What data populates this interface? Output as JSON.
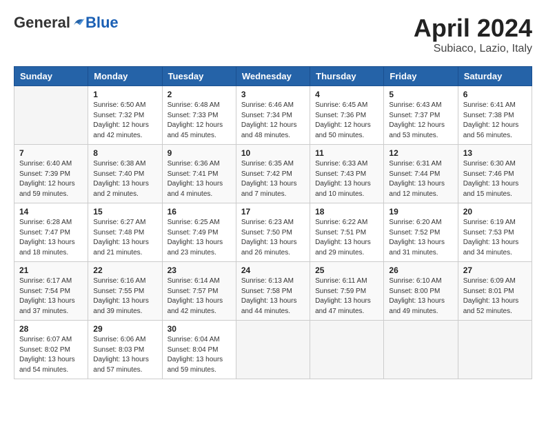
{
  "logo": {
    "general": "General",
    "blue": "Blue"
  },
  "header": {
    "title": "April 2024",
    "subtitle": "Subiaco, Lazio, Italy"
  },
  "days_of_week": [
    "Sunday",
    "Monday",
    "Tuesday",
    "Wednesday",
    "Thursday",
    "Friday",
    "Saturday"
  ],
  "weeks": [
    [
      {
        "day": "",
        "info": ""
      },
      {
        "day": "1",
        "info": "Sunrise: 6:50 AM\nSunset: 7:32 PM\nDaylight: 12 hours\nand 42 minutes."
      },
      {
        "day": "2",
        "info": "Sunrise: 6:48 AM\nSunset: 7:33 PM\nDaylight: 12 hours\nand 45 minutes."
      },
      {
        "day": "3",
        "info": "Sunrise: 6:46 AM\nSunset: 7:34 PM\nDaylight: 12 hours\nand 48 minutes."
      },
      {
        "day": "4",
        "info": "Sunrise: 6:45 AM\nSunset: 7:36 PM\nDaylight: 12 hours\nand 50 minutes."
      },
      {
        "day": "5",
        "info": "Sunrise: 6:43 AM\nSunset: 7:37 PM\nDaylight: 12 hours\nand 53 minutes."
      },
      {
        "day": "6",
        "info": "Sunrise: 6:41 AM\nSunset: 7:38 PM\nDaylight: 12 hours\nand 56 minutes."
      }
    ],
    [
      {
        "day": "7",
        "info": "Sunrise: 6:40 AM\nSunset: 7:39 PM\nDaylight: 12 hours\nand 59 minutes."
      },
      {
        "day": "8",
        "info": "Sunrise: 6:38 AM\nSunset: 7:40 PM\nDaylight: 13 hours\nand 2 minutes."
      },
      {
        "day": "9",
        "info": "Sunrise: 6:36 AM\nSunset: 7:41 PM\nDaylight: 13 hours\nand 4 minutes."
      },
      {
        "day": "10",
        "info": "Sunrise: 6:35 AM\nSunset: 7:42 PM\nDaylight: 13 hours\nand 7 minutes."
      },
      {
        "day": "11",
        "info": "Sunrise: 6:33 AM\nSunset: 7:43 PM\nDaylight: 13 hours\nand 10 minutes."
      },
      {
        "day": "12",
        "info": "Sunrise: 6:31 AM\nSunset: 7:44 PM\nDaylight: 13 hours\nand 12 minutes."
      },
      {
        "day": "13",
        "info": "Sunrise: 6:30 AM\nSunset: 7:46 PM\nDaylight: 13 hours\nand 15 minutes."
      }
    ],
    [
      {
        "day": "14",
        "info": "Sunrise: 6:28 AM\nSunset: 7:47 PM\nDaylight: 13 hours\nand 18 minutes."
      },
      {
        "day": "15",
        "info": "Sunrise: 6:27 AM\nSunset: 7:48 PM\nDaylight: 13 hours\nand 21 minutes."
      },
      {
        "day": "16",
        "info": "Sunrise: 6:25 AM\nSunset: 7:49 PM\nDaylight: 13 hours\nand 23 minutes."
      },
      {
        "day": "17",
        "info": "Sunrise: 6:23 AM\nSunset: 7:50 PM\nDaylight: 13 hours\nand 26 minutes."
      },
      {
        "day": "18",
        "info": "Sunrise: 6:22 AM\nSunset: 7:51 PM\nDaylight: 13 hours\nand 29 minutes."
      },
      {
        "day": "19",
        "info": "Sunrise: 6:20 AM\nSunset: 7:52 PM\nDaylight: 13 hours\nand 31 minutes."
      },
      {
        "day": "20",
        "info": "Sunrise: 6:19 AM\nSunset: 7:53 PM\nDaylight: 13 hours\nand 34 minutes."
      }
    ],
    [
      {
        "day": "21",
        "info": "Sunrise: 6:17 AM\nSunset: 7:54 PM\nDaylight: 13 hours\nand 37 minutes."
      },
      {
        "day": "22",
        "info": "Sunrise: 6:16 AM\nSunset: 7:55 PM\nDaylight: 13 hours\nand 39 minutes."
      },
      {
        "day": "23",
        "info": "Sunrise: 6:14 AM\nSunset: 7:57 PM\nDaylight: 13 hours\nand 42 minutes."
      },
      {
        "day": "24",
        "info": "Sunrise: 6:13 AM\nSunset: 7:58 PM\nDaylight: 13 hours\nand 44 minutes."
      },
      {
        "day": "25",
        "info": "Sunrise: 6:11 AM\nSunset: 7:59 PM\nDaylight: 13 hours\nand 47 minutes."
      },
      {
        "day": "26",
        "info": "Sunrise: 6:10 AM\nSunset: 8:00 PM\nDaylight: 13 hours\nand 49 minutes."
      },
      {
        "day": "27",
        "info": "Sunrise: 6:09 AM\nSunset: 8:01 PM\nDaylight: 13 hours\nand 52 minutes."
      }
    ],
    [
      {
        "day": "28",
        "info": "Sunrise: 6:07 AM\nSunset: 8:02 PM\nDaylight: 13 hours\nand 54 minutes."
      },
      {
        "day": "29",
        "info": "Sunrise: 6:06 AM\nSunset: 8:03 PM\nDaylight: 13 hours\nand 57 minutes."
      },
      {
        "day": "30",
        "info": "Sunrise: 6:04 AM\nSunset: 8:04 PM\nDaylight: 13 hours\nand 59 minutes."
      },
      {
        "day": "",
        "info": ""
      },
      {
        "day": "",
        "info": ""
      },
      {
        "day": "",
        "info": ""
      },
      {
        "day": "",
        "info": ""
      }
    ]
  ]
}
